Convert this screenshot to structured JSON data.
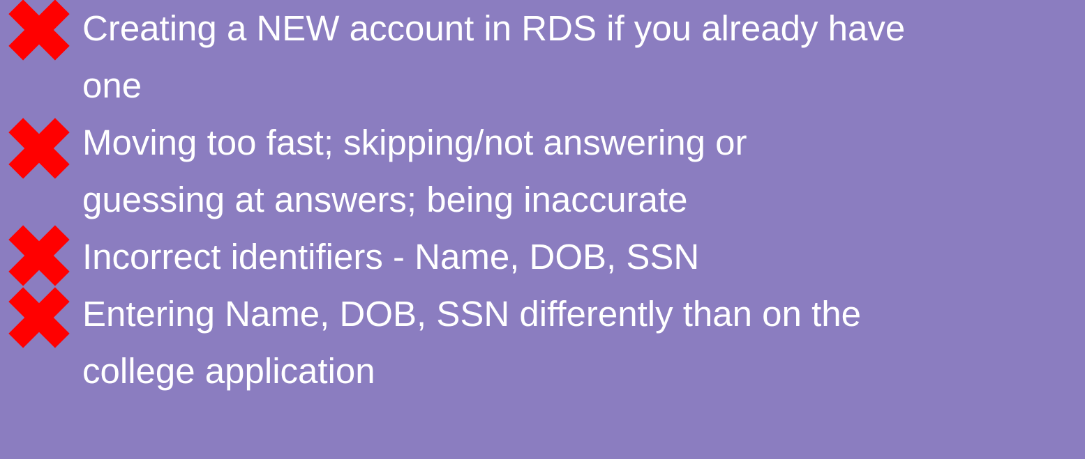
{
  "slide": {
    "background_color": "#8b7dc0",
    "text_color": "#ffffff",
    "bullet_icon": "red-x-icon",
    "bullet_icon_color": "#ff0000",
    "items": [
      {
        "lines": [
          "Creating a NEW account in RDS if you already have",
          "one"
        ]
      },
      {
        "lines": [
          "Moving too fast; skipping/not answering or",
          "guessing at answers; being inaccurate"
        ]
      },
      {
        "lines": [
          "Incorrect identifiers - Name, DOB, SSN"
        ]
      },
      {
        "lines": [
          "Entering Name, DOB, SSN differently than on the",
          "college application"
        ]
      }
    ]
  }
}
